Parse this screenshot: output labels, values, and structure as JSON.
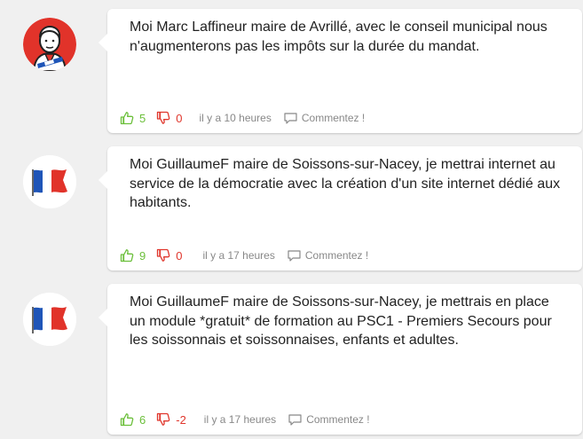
{
  "posts": [
    {
      "text": "Moi Marc Laffineur maire de Avrillé, avec le conseil municipal nous n'augmenterons pas les impôts sur la durée du mandat.",
      "likes": "5",
      "dislikes": "0",
      "time": "il y a 10 heures",
      "comment_label": "Commentez !",
      "avatar_icon": "mayor-avatar-icon"
    },
    {
      "text": "Moi GuillaumeF maire de Soissons-sur-Nacey, je mettrai internet au service de la démocratie avec la création d'un site internet dédié aux habitants.",
      "likes": "9",
      "dislikes": "0",
      "time": "il y a 17 heures",
      "comment_label": "Commentez !",
      "avatar_icon": "french-flag-icon"
    },
    {
      "text": "Moi GuillaumeF maire de Soissons-sur-Nacey, je mettrais en place un module *gratuit* de formation au PSC1 - Premiers Secours pour les soissonnais et soissonnaises, enfants et adultes.",
      "likes": "6",
      "dislikes": "-2",
      "time": "il y a 17 heures",
      "comment_label": "Commentez !",
      "avatar_icon": "french-flag-icon"
    }
  ],
  "colors": {
    "like": "#6bbf3a",
    "dislike": "#e0362c",
    "meta": "#888888",
    "background": "#f0f0f0",
    "card": "#ffffff",
    "flag_blue": "#1f55b8",
    "flag_red": "#e1332a"
  }
}
